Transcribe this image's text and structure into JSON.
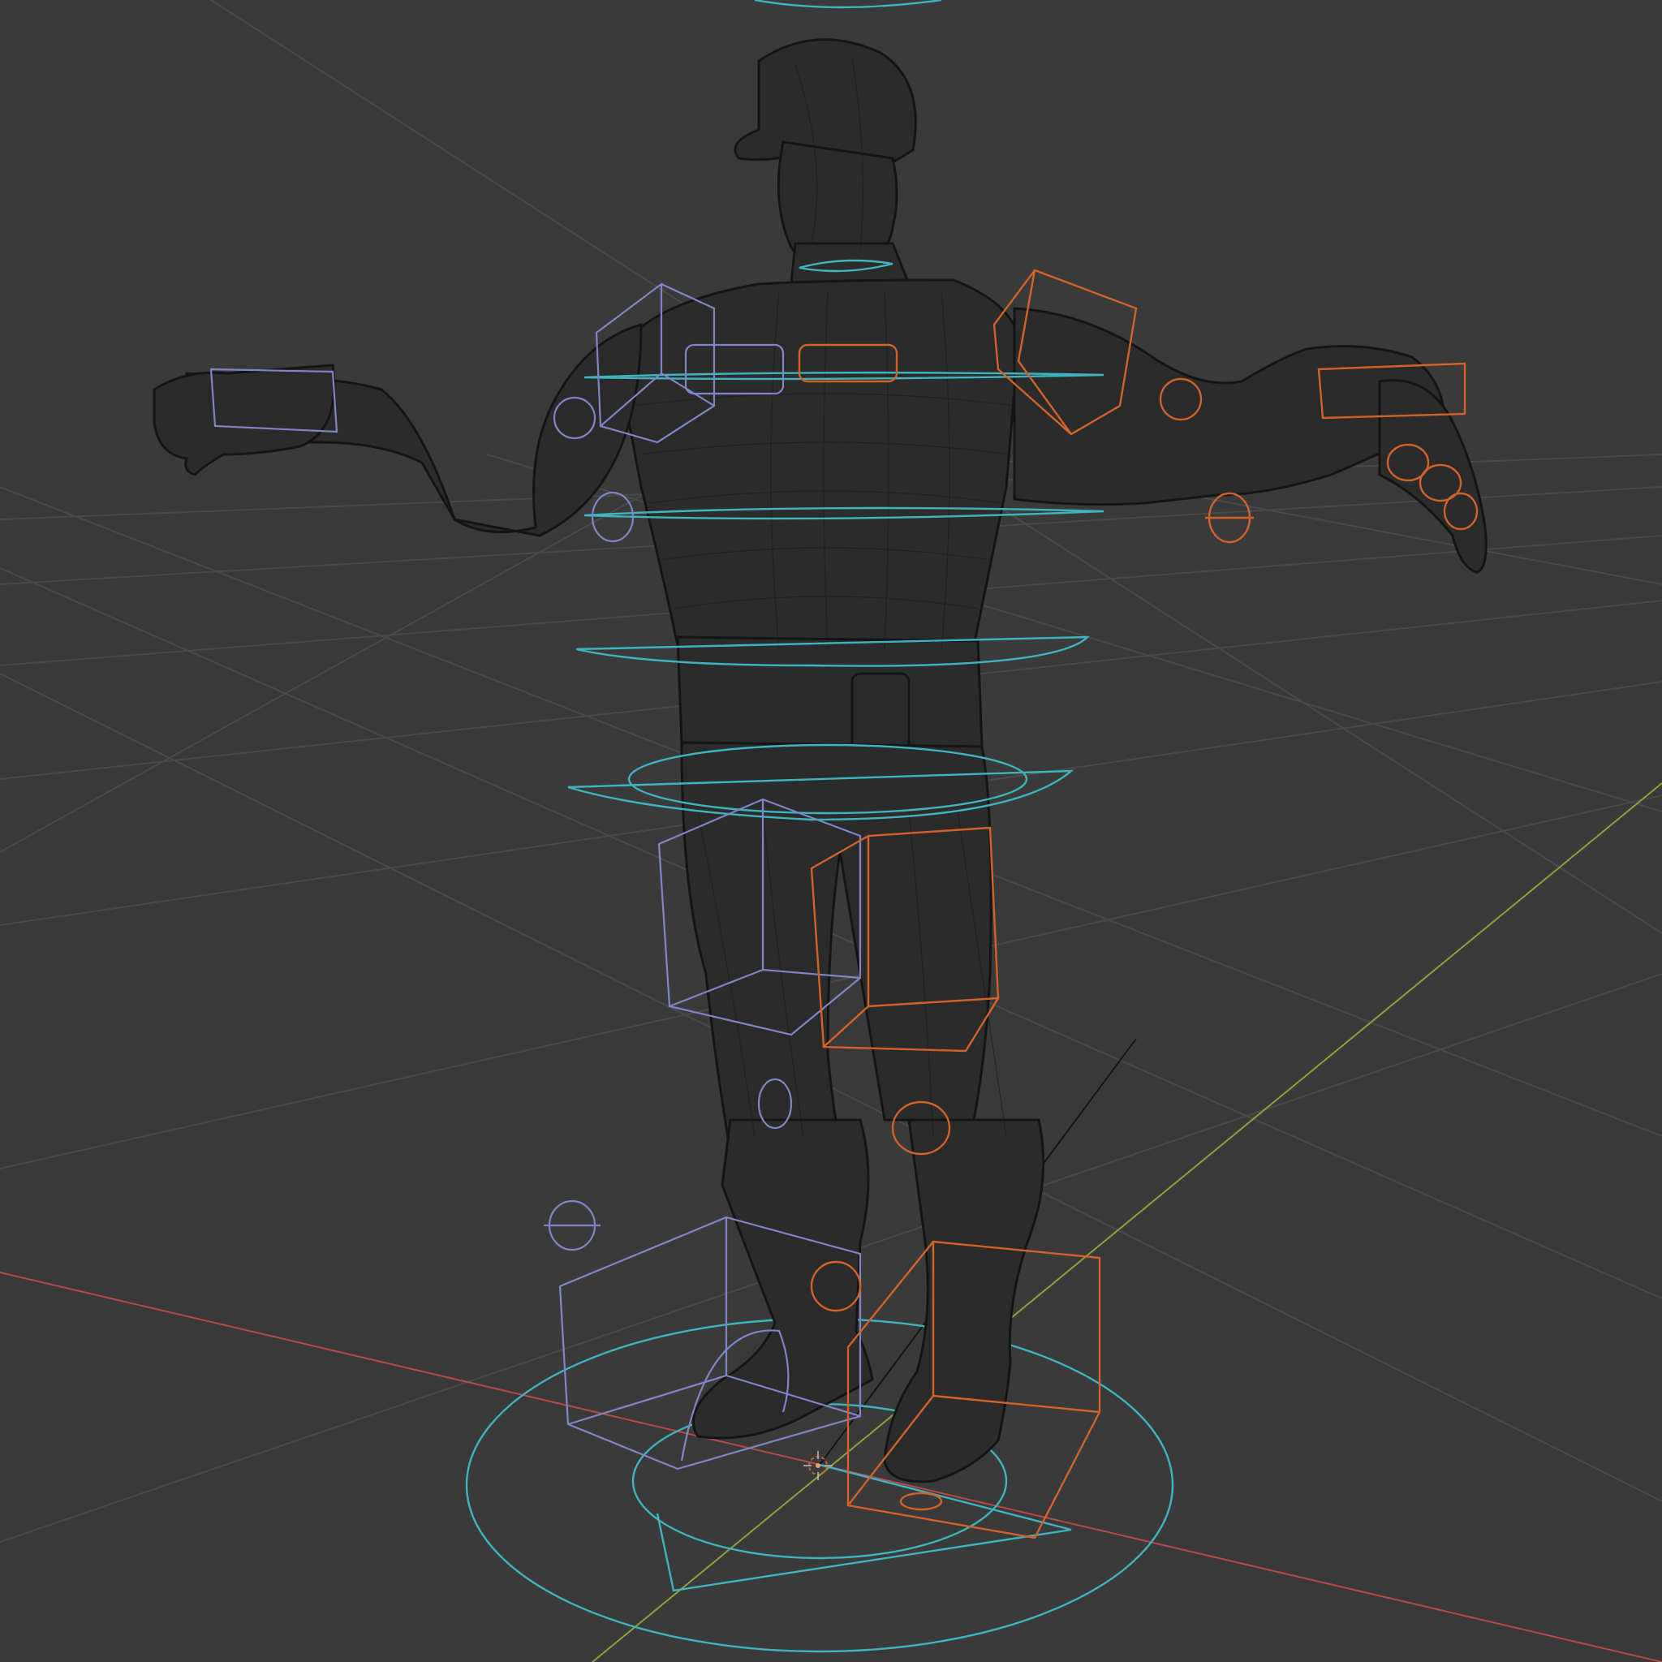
{
  "viewport": {
    "mode": "wireframe",
    "background_color": "#3a3a3a",
    "grid_color": "#4a4a4a",
    "mesh_color": "#2b2b2b",
    "axis_x_color": "#b84a4a",
    "axis_y_color": "#8aa23a",
    "controls_center_color": "#3fb3bf",
    "controls_left_color": "#7e86c8",
    "controls_right_color": "#d2622a"
  }
}
